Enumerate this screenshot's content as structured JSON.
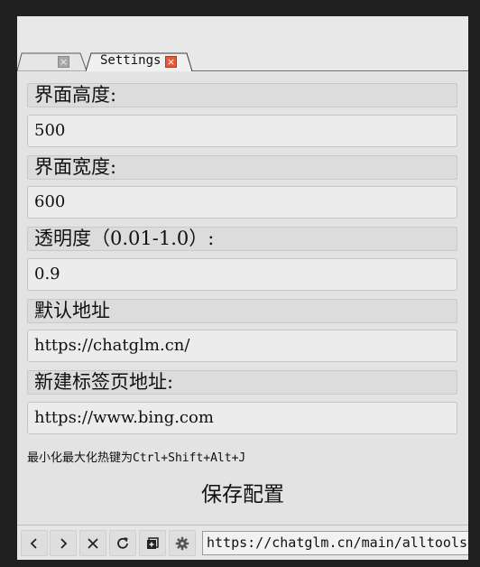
{
  "tabs": [
    {
      "label": "",
      "close_icon": "close-icon",
      "active": false
    },
    {
      "label": "Settings",
      "close_icon": "close-icon",
      "active": true
    }
  ],
  "form": {
    "height_label": "界面高度:",
    "height_value": "500",
    "width_label": "界面宽度:",
    "width_value": "600",
    "opacity_label": "透明度（0.01-1.0）:",
    "opacity_value": "0.9",
    "default_url_label": "默认地址",
    "default_url_value": "https://chatglm.cn/",
    "new_tab_label": "新建标签页地址:",
    "new_tab_value": "https://www.bing.com",
    "hotkey_hint": "最小化最大化热键为Ctrl+Shift+Alt+J",
    "save_label": "保存配置"
  },
  "toolbar": {
    "buttons": [
      "chevron-left-icon",
      "chevron-right-icon",
      "close-icon",
      "refresh-icon",
      "new-tab-icon",
      "gear-icon"
    ],
    "url": "https://chatglm.cn/main/alltoolsdeta"
  },
  "colors": {
    "active_close": "#e05a3c",
    "inactive_close": "#a0a0a0",
    "window_bg": "#e3e3e3",
    "outer_bg": "#202020"
  }
}
